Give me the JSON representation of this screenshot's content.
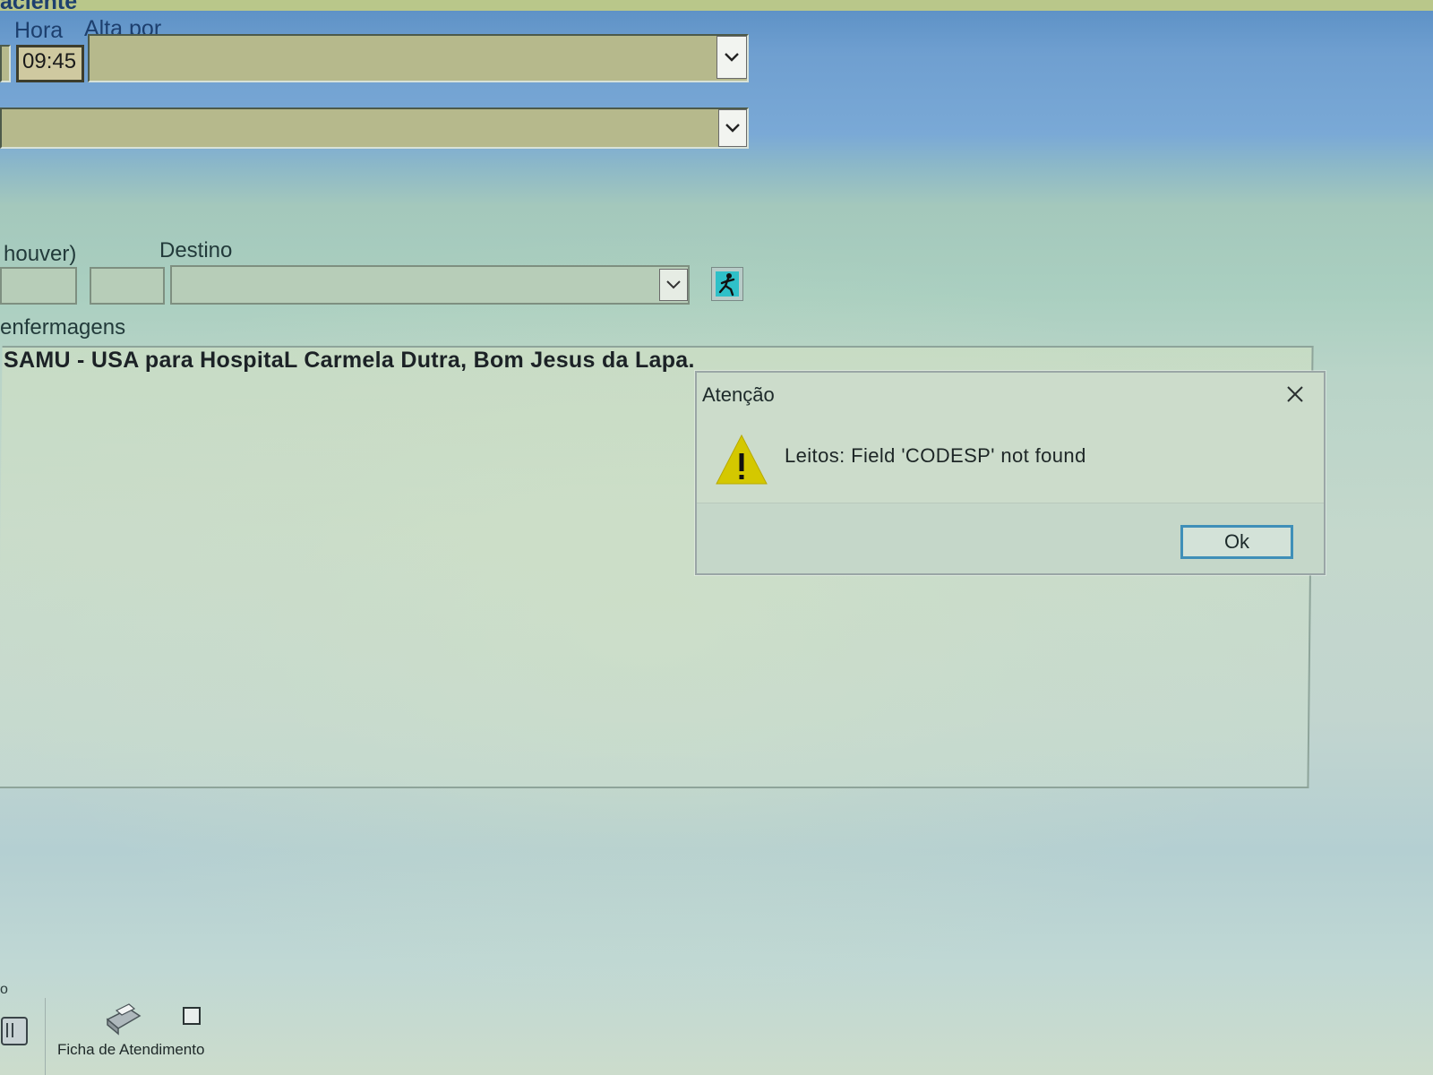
{
  "header": {
    "partial_title": "aciente",
    "hora_label": "Hora",
    "alta_por_label": "Alta por",
    "hora_value": "09:45",
    "alta_por_value": "",
    "second_select_value": ""
  },
  "transfer": {
    "partial_label": "houver)",
    "destino_label": "Destino",
    "destino_value": "",
    "action_icon": "running-person-icon"
  },
  "notes": {
    "partial_label": "enfermagens",
    "text": "SAMU - USA para HospitaL Carmela Dutra, Bom Jesus da Lapa."
  },
  "dialog": {
    "title": "Atenção",
    "message": "Leitos: Field 'CODESP' not found",
    "ok_label": "Ok",
    "icon": "warning-icon",
    "icon_color": "#d4c800"
  },
  "bottom_bar": {
    "partial_label": "o",
    "ficha_label": "Ficha de Atendimento",
    "ficha_icon": "printer-icon"
  },
  "colors": {
    "header_blue": "#6f9fd0",
    "label_blue": "#1d3f6e",
    "field_khaki": "#b6b98c",
    "ok_border": "#3f8fb8"
  }
}
